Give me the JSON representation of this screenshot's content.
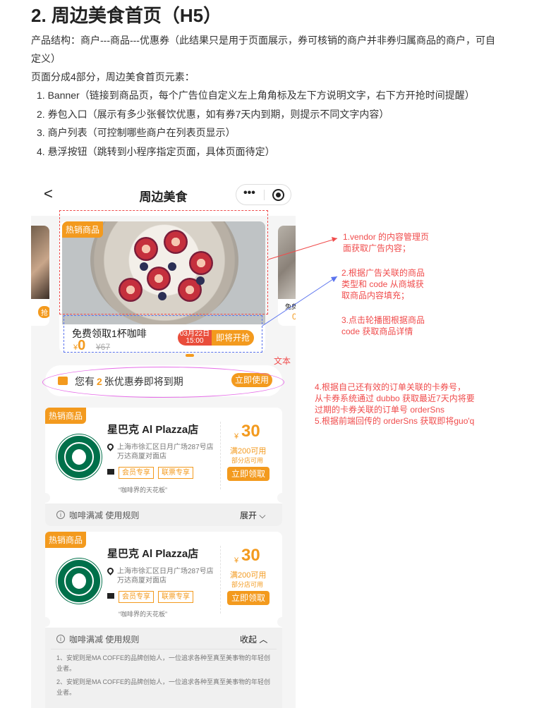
{
  "doc": {
    "title": "2. 周边美食首页（H5）",
    "structure_line1": "产品结构：商户---商品---优惠券（此结果只是用于页面展示，券可核销的商户并非券归属商品的商户，可自",
    "structure_line2": "定义）",
    "section_intro": "页面分成4部分，周边美食首页元素：",
    "items": [
      "1. Banner（链接到商品页，每个广告位自定义左上角角标及左下方说明文字，右下方开抢时间提醒）",
      "2. 券包入口（展示有多少张餐饮优惠，如有券7天内到期，则提示不同文字内容）",
      "3. 商户列表（可控制哪些商户在列表页显示）",
      "4. 悬浮按钮（跳转到小程序指定页面，具体页面待定）"
    ]
  },
  "phone": {
    "nav": {
      "back": "<",
      "title": "周边美食",
      "more": "•••"
    },
    "left_card_tag": "抢",
    "right_card_label": "免费",
    "right_card_tag": "0",
    "banner": {
      "hot_tag": "热销商品",
      "promo_name": "免费领取1杯咖啡",
      "currency": "¥",
      "price": "0",
      "old_price": "¥67",
      "date": "03月22日",
      "time": "15:00",
      "soon": "即将开抢"
    },
    "voucher": {
      "prefix": "您有",
      "count": "2",
      "suffix": "张优惠券即将到期",
      "button": "立即使用"
    },
    "shops": [
      {
        "hot_tag": "热销商品",
        "name": "星巴克 Al Plazza店",
        "address": "上海市徐汇区日月广场287号店万达商厦对面店",
        "tags": [
          "会员专享",
          "联票专享"
        ],
        "slogan": "“咖啡界的天花板”",
        "currency": "¥",
        "price": "30",
        "condition": "满200可用",
        "scope": "部分店可用",
        "claim": "立即领取",
        "foot_text": "咖啡满减 使用规则",
        "toggle": "展开",
        "rules": []
      },
      {
        "hot_tag": "热销商品",
        "name": "星巴克 Al Plazza店",
        "address": "上海市徐汇区日月广场287号店万达商厦对面店",
        "tags": [
          "会员专享",
          "联票专享"
        ],
        "slogan": "“咖啡界的天花板”",
        "currency": "¥",
        "price": "30",
        "condition": "满200可用",
        "scope": "部分店可用",
        "claim": "立即领取",
        "foot_text": "咖啡满减 使用规则",
        "toggle": "收起",
        "rules": [
          "1、安妮则是MA COFFE的品牌创始人，一位追求各种至真至美事物的年轻创业者。",
          "2、安妮则是MA COFFE的品牌创始人，一位追求各种至真至美事物的年轻创业者。"
        ]
      }
    ]
  },
  "annotations": {
    "vendor": [
      "1.vendor 的内容管理页",
      "面获取广告内容；"
    ],
    "mapping": [
      "2.根据广告关联的商品",
      "类型和 code 从商城获",
      "取商品内容填充；"
    ],
    "click": [
      "3.点击轮播图根据商品",
      "code 获取商品详情"
    ],
    "text_label": "文本",
    "voucher_logic": [
      "4.根据自己还有效的订单关联的卡券号，",
      "从卡券系统通过 dubbo 获取最近7天内将要",
      "过期的卡券关联的订单号 orderSns",
      "5.根据前端回传的 orderSns 获取即将guo'q"
    ]
  },
  "colors": {
    "accent": "#f39a1e",
    "annotation_red": "#f04c4c",
    "annotation_blue": "#5a73ee",
    "highlight_pink": "#e66ee8"
  }
}
